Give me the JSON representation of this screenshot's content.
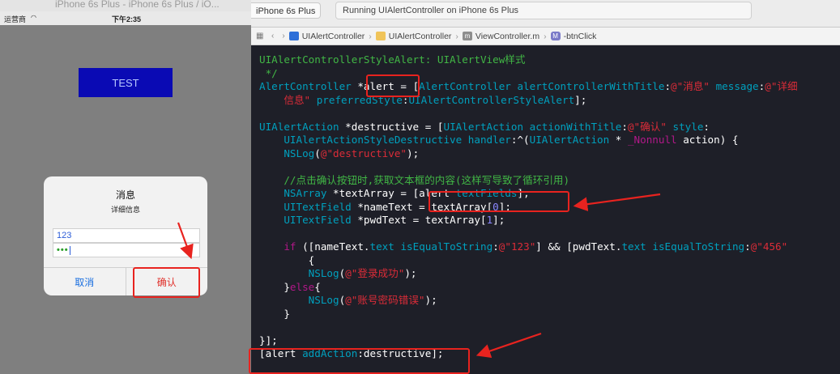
{
  "simulator": {
    "window_title": "iPhone 6s Plus - iPhone 6s Plus / iO...",
    "status": {
      "carrier": "运营商",
      "time": "下午2:35"
    },
    "test_button": "TEST",
    "alert": {
      "title": "消息",
      "message": "详细信息",
      "name_value": "123",
      "password_mask": "•••",
      "cancel_label": "取消",
      "confirm_label": "确认"
    }
  },
  "xcode": {
    "scheme_destination": "iPhone 6s Plus",
    "activity_status": "Running UIAlertController on iPhone 6s Plus",
    "jump_bar": [
      "UIAlertController",
      "UIAlertController",
      "ViewController.m",
      "-btnClick"
    ],
    "code_lines": [
      [
        {
          "t": "UIAlertControllerStyleAlert: UIAlertView样式",
          "c": "comment"
        }
      ],
      [
        {
          "t": " */",
          "c": "comment"
        }
      ],
      [
        {
          "t": "AlertController ",
          "c": "type"
        },
        {
          "t": "*alert ",
          "c": "plain"
        },
        {
          "t": "= [",
          "c": "plain"
        },
        {
          "t": "AlertController alertControllerWithTitle",
          "c": "type"
        },
        {
          "t": ":",
          "c": "plain"
        },
        {
          "t": "@\"消息\"",
          "c": "string"
        },
        {
          "t": " message",
          "c": "type"
        },
        {
          "t": ":",
          "c": "plain"
        },
        {
          "t": "@\"详细",
          "c": "string"
        }
      ],
      [
        {
          "t": "    ",
          "c": "plain"
        },
        {
          "t": "信息\"",
          "c": "string"
        },
        {
          "t": " preferredStyle",
          "c": "type"
        },
        {
          "t": ":",
          "c": "plain"
        },
        {
          "t": "UIAlertControllerStyleAlert",
          "c": "type"
        },
        {
          "t": "];",
          "c": "plain"
        }
      ],
      [],
      [
        {
          "t": "UIAlertAction ",
          "c": "type"
        },
        {
          "t": "*destructive = [",
          "c": "plain"
        },
        {
          "t": "UIAlertAction actionWithTitle",
          "c": "type"
        },
        {
          "t": ":",
          "c": "plain"
        },
        {
          "t": "@\"确认\"",
          "c": "string"
        },
        {
          "t": " style",
          "c": "type"
        },
        {
          "t": ":",
          "c": "plain"
        }
      ],
      [
        {
          "t": "    ",
          "c": "plain"
        },
        {
          "t": "UIAlertActionStyleDestructive handler",
          "c": "type"
        },
        {
          "t": ":^(",
          "c": "plain"
        },
        {
          "t": "UIAlertAction",
          "c": "type"
        },
        {
          "t": " * ",
          "c": "plain"
        },
        {
          "t": "_Nonnull",
          "c": "keyword"
        },
        {
          "t": " action) {",
          "c": "plain"
        }
      ],
      [
        {
          "t": "    ",
          "c": "plain"
        },
        {
          "t": "NSLog",
          "c": "type"
        },
        {
          "t": "(",
          "c": "plain"
        },
        {
          "t": "@\"destructive\"",
          "c": "string"
        },
        {
          "t": ");",
          "c": "plain"
        }
      ],
      [],
      [
        {
          "t": "    ",
          "c": "plain"
        },
        {
          "t": "//点击确认按钮时,获取文本框的内容(这样写导致了循环引用)",
          "c": "comment"
        }
      ],
      [
        {
          "t": "    ",
          "c": "plain"
        },
        {
          "t": "NSArray ",
          "c": "type"
        },
        {
          "t": "*textArray = [alert ",
          "c": "plain"
        },
        {
          "t": "textFields",
          "c": "type"
        },
        {
          "t": "];",
          "c": "plain"
        }
      ],
      [
        {
          "t": "    ",
          "c": "plain"
        },
        {
          "t": "UITextField ",
          "c": "type"
        },
        {
          "t": "*nameText = textArray[",
          "c": "plain"
        },
        {
          "t": "0",
          "c": "number"
        },
        {
          "t": "];",
          "c": "plain"
        }
      ],
      [
        {
          "t": "    ",
          "c": "plain"
        },
        {
          "t": "UITextField ",
          "c": "type"
        },
        {
          "t": "*pwdText = textArray[",
          "c": "plain"
        },
        {
          "t": "1",
          "c": "number"
        },
        {
          "t": "];",
          "c": "plain"
        }
      ],
      [],
      [
        {
          "t": "    ",
          "c": "plain"
        },
        {
          "t": "if",
          "c": "keyword"
        },
        {
          "t": " ([nameText.",
          "c": "plain"
        },
        {
          "t": "text",
          "c": "type"
        },
        {
          "t": " ",
          "c": "plain"
        },
        {
          "t": "isEqualToString",
          "c": "type"
        },
        {
          "t": ":",
          "c": "plain"
        },
        {
          "t": "@\"123\"",
          "c": "string"
        },
        {
          "t": "] && [pwdText.",
          "c": "plain"
        },
        {
          "t": "text",
          "c": "type"
        },
        {
          "t": " ",
          "c": "plain"
        },
        {
          "t": "isEqualToString",
          "c": "type"
        },
        {
          "t": ":",
          "c": "plain"
        },
        {
          "t": "@\"456\"",
          "c": "string"
        }
      ],
      [
        {
          "t": "        {",
          "c": "plain"
        }
      ],
      [
        {
          "t": "        ",
          "c": "plain"
        },
        {
          "t": "NSLog",
          "c": "type"
        },
        {
          "t": "(",
          "c": "plain"
        },
        {
          "t": "@\"登录成功\"",
          "c": "string"
        },
        {
          "t": ");",
          "c": "plain"
        }
      ],
      [
        {
          "t": "    }",
          "c": "plain"
        },
        {
          "t": "else",
          "c": "keyword"
        },
        {
          "t": "{",
          "c": "plain"
        }
      ],
      [
        {
          "t": "        ",
          "c": "plain"
        },
        {
          "t": "NSLog",
          "c": "type"
        },
        {
          "t": "(",
          "c": "plain"
        },
        {
          "t": "@\"账号密码错误\"",
          "c": "string"
        },
        {
          "t": ");",
          "c": "plain"
        }
      ],
      [
        {
          "t": "    }",
          "c": "plain"
        }
      ],
      [],
      [
        {
          "t": "}];",
          "c": "plain"
        }
      ],
      [
        {
          "t": "[alert ",
          "c": "plain"
        },
        {
          "t": "addAction",
          "c": "type"
        },
        {
          "t": ":destructive];",
          "c": "plain"
        }
      ]
    ]
  },
  "colors": {
    "annotation_red": "#e8231f",
    "editor_background": "#1e1f28",
    "comment_green": "#41b645",
    "type_cyan": "#00a0be",
    "string_red": "#db2c38"
  }
}
